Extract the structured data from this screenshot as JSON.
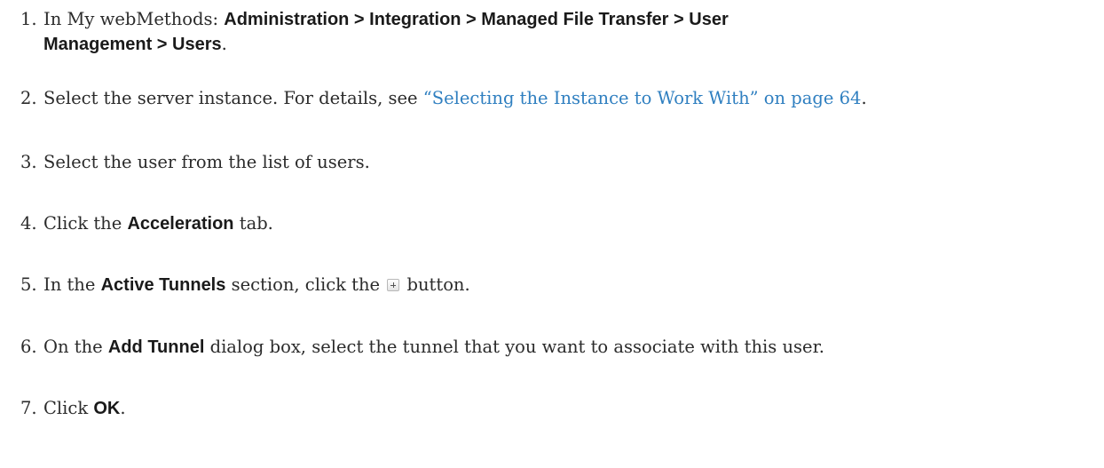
{
  "steps": [
    {
      "num": "1.",
      "pre": "In My webMethods: ",
      "path_line1": "Administration > Integration > Managed File Transfer > User",
      "path_line2": "Management > Users",
      "post": "."
    },
    {
      "num": "2.",
      "pre": "Select the server instance. For details, see ",
      "link": "“Selecting the Instance to Work With” on page 64",
      "post": "."
    },
    {
      "num": "3.",
      "text": "Select the user from the list of users."
    },
    {
      "num": "4.",
      "pre": "Click the ",
      "bold": "Acceleration",
      "post": " tab."
    },
    {
      "num": "5.",
      "pre": "In the ",
      "bold": "Active Tunnels",
      "mid": " section, click the ",
      "icon": "plus-icon",
      "post": " button."
    },
    {
      "num": "6.",
      "pre": "On the ",
      "bold": "Add Tunnel",
      "post": " dialog box, select the tunnel that you want to associate with this user."
    },
    {
      "num": "7.",
      "pre": "Click ",
      "bold": "OK",
      "post": "."
    }
  ]
}
